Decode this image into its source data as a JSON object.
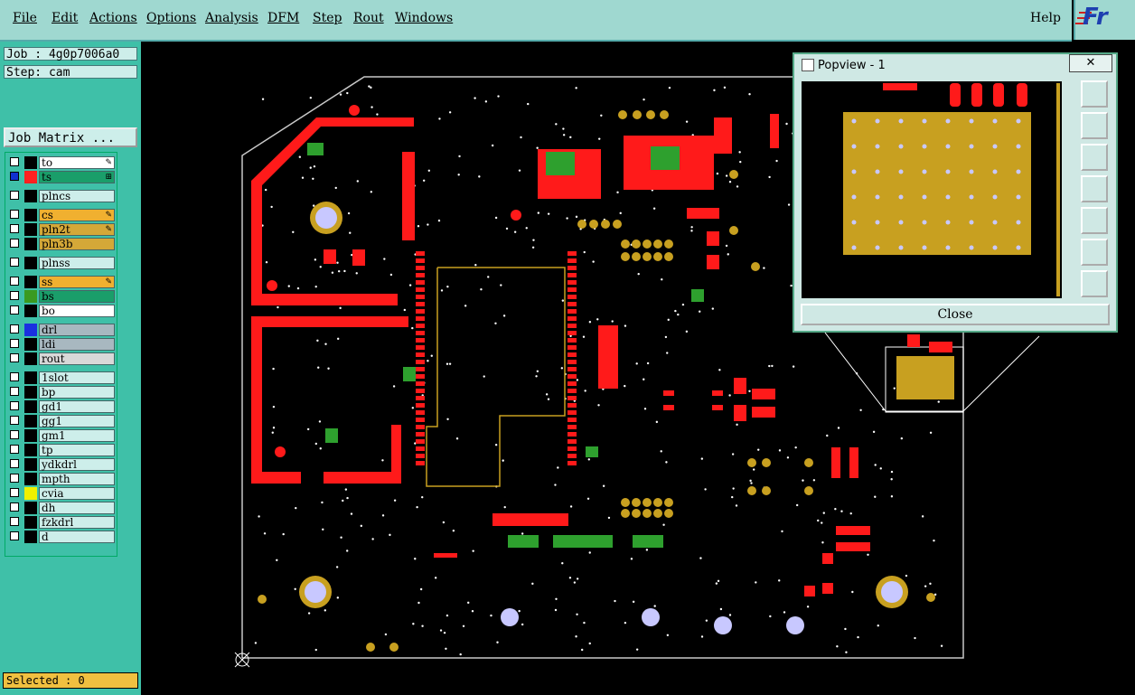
{
  "menu": {
    "items": [
      "File",
      "Edit",
      "Actions",
      "Options",
      "Analysis",
      "DFM",
      "Step",
      "Rout",
      "Windows"
    ],
    "help": "Help",
    "logo": "Fr"
  },
  "job": {
    "job_label": "Job : 4g0p7006a0",
    "step_label": "Step: cam",
    "matrix_button": "Job Matrix ..."
  },
  "layers": [
    {
      "name": "to",
      "color": "#ffffff",
      "swatch": "#000000",
      "checked": false,
      "icon": "edit"
    },
    {
      "name": "ts",
      "color": "#1a9e6a",
      "swatch": "#ff2020",
      "checked": true,
      "icon": "plus"
    },
    {
      "name": "plncs",
      "color": "#cdeeea",
      "swatch": "#000000",
      "checked": false
    },
    {
      "name": "cs",
      "color": "#f0b030",
      "swatch": "#000000",
      "checked": false,
      "icon": "edit"
    },
    {
      "name": "pln2t",
      "color": "#d4a838",
      "swatch": "#000000",
      "checked": false,
      "icon": "edit"
    },
    {
      "name": "pln3b",
      "color": "#d4a838",
      "swatch": "#000000",
      "checked": false
    },
    {
      "name": "plnss",
      "color": "#cdeeea",
      "swatch": "#000000",
      "checked": false
    },
    {
      "name": "ss",
      "color": "#f0b030",
      "swatch": "#000000",
      "checked": false,
      "icon": "edit"
    },
    {
      "name": "bs",
      "color": "#1a9e6a",
      "swatch": "#3a9a20",
      "checked": false
    },
    {
      "name": "bo",
      "color": "#ffffff",
      "swatch": "#000000",
      "checked": false
    },
    {
      "name": "drl",
      "color": "#a8b8c0",
      "swatch": "#1a30e0",
      "checked": false
    },
    {
      "name": "ldi",
      "color": "#a8b8c0",
      "swatch": "#000000",
      "checked": false
    },
    {
      "name": "rout",
      "color": "#d8d8d8",
      "swatch": "#000000",
      "checked": false
    },
    {
      "name": "1slot",
      "color": "#cdeeea",
      "swatch": "#000000",
      "checked": false
    },
    {
      "name": "bp",
      "color": "#cdeeea",
      "swatch": "#000000",
      "checked": false
    },
    {
      "name": "gd1",
      "color": "#cdeeea",
      "swatch": "#000000",
      "checked": false
    },
    {
      "name": "gg1",
      "color": "#cdeeea",
      "swatch": "#000000",
      "checked": false
    },
    {
      "name": "gm1",
      "color": "#cdeeea",
      "swatch": "#000000",
      "checked": false
    },
    {
      "name": "tp",
      "color": "#cdeeea",
      "swatch": "#000000",
      "checked": false
    },
    {
      "name": "ydkdrl",
      "color": "#cdeeea",
      "swatch": "#000000",
      "checked": false
    },
    {
      "name": "mpth",
      "color": "#cdeeea",
      "swatch": "#000000",
      "checked": false
    },
    {
      "name": "cvia",
      "color": "#cdeeea",
      "swatch": "#f0f000",
      "checked": false
    },
    {
      "name": "dh",
      "color": "#cdeeea",
      "swatch": "#000000",
      "checked": false
    },
    {
      "name": "fzkdrl",
      "color": "#cdeeea",
      "swatch": "#000000",
      "checked": false
    },
    {
      "name": "d",
      "color": "#cdeeea",
      "swatch": "#000000",
      "checked": false
    }
  ],
  "status": {
    "selected": "Selected : 0"
  },
  "popview": {
    "title": "Popview - 1",
    "close_button": "Close",
    "close_x": "✕"
  },
  "colors": {
    "copper_red": "#ff1a1a",
    "pad_gold": "#c8a020",
    "via_white": "#c8c8ff",
    "board_outline": "#c8c8c8",
    "green": "#2ea02e"
  }
}
